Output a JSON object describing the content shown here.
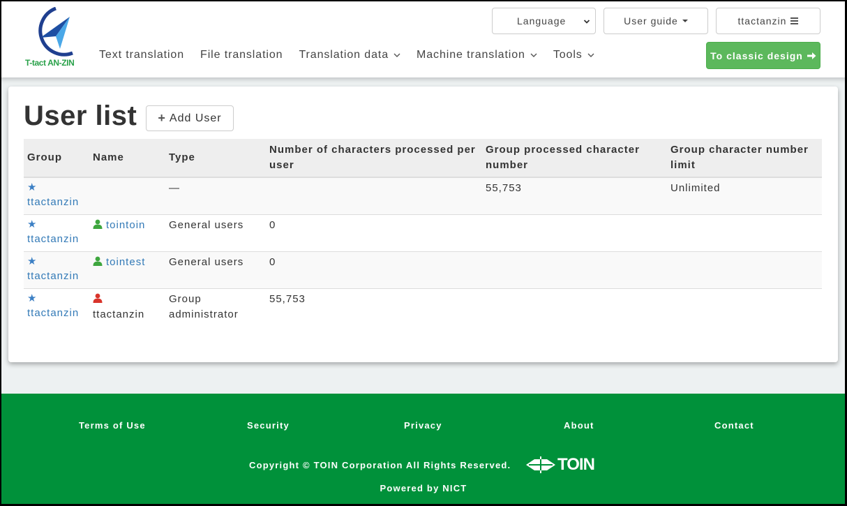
{
  "brand": {
    "logo_text": "T-tact AN-ZIN",
    "accent_green": "#5cb85c",
    "footer_green": "#00913a",
    "link_blue": "#337ab7"
  },
  "header": {
    "nav": [
      {
        "label": "Text translation",
        "has_dropdown": false
      },
      {
        "label": "File translation",
        "has_dropdown": false
      },
      {
        "label": "Translation data",
        "has_dropdown": true
      },
      {
        "label": "Machine translation",
        "has_dropdown": true
      },
      {
        "label": "Tools",
        "has_dropdown": true
      }
    ],
    "language_select": {
      "selected": "Language"
    },
    "user_guide_label": "User guide",
    "user_menu_label": "ttactanzin",
    "classic_design_label": "To classic design"
  },
  "main": {
    "title": "User list",
    "add_user_label": "Add User",
    "table": {
      "columns": [
        "Group",
        "Name",
        "Type",
        "Number of characters processed per user",
        "Group processed character number",
        "Group character number limit"
      ],
      "rows": [
        {
          "group": "ttactanzin",
          "name": "",
          "name_icon": "none",
          "name_is_link": false,
          "type": "—",
          "chars_per_user": "",
          "group_processed": "55,753",
          "group_limit": "Unlimited"
        },
        {
          "group": "ttactanzin",
          "name": "tointoin",
          "name_icon": "user-green",
          "name_is_link": true,
          "type": "General users",
          "chars_per_user": "0",
          "group_processed": "",
          "group_limit": ""
        },
        {
          "group": "ttactanzin",
          "name": "tointest",
          "name_icon": "user-green",
          "name_is_link": true,
          "type": "General users",
          "chars_per_user": "0",
          "group_processed": "",
          "group_limit": ""
        },
        {
          "group": "ttactanzin",
          "name": "ttactanzin",
          "name_icon": "user-red",
          "name_is_link": false,
          "type": "Group administrator",
          "chars_per_user": "55,753",
          "group_processed": "",
          "group_limit": ""
        }
      ]
    }
  },
  "footer": {
    "links": [
      "Terms of Use",
      "Security",
      "Privacy",
      "About",
      "Contact"
    ],
    "copyright": "Copyright © TOIN Corporation All Rights Reserved.",
    "toin_logo_text": "TOIN",
    "powered_by": "Powered by NICT"
  }
}
